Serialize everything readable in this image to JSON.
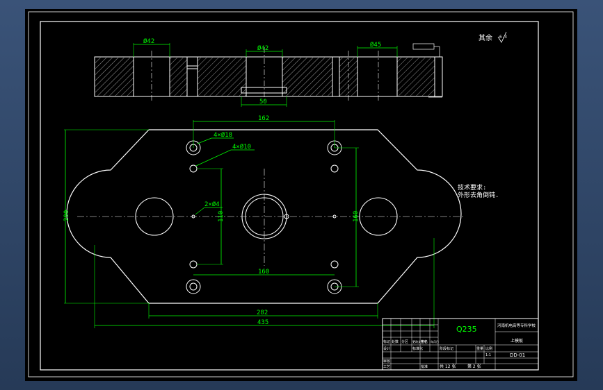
{
  "drawing": {
    "roughness_label": "其余",
    "roughness_value": "6.3",
    "tech_title": "技术要求:",
    "tech_note": "外形去角倒钝.",
    "material": "Q235",
    "school": "河南机电高等专科学校",
    "part_name": "上模板",
    "drawing_no": "DD-01",
    "scale": "1:1",
    "sheet_total": "共 12 张",
    "sheet_no": "第 2 张"
  },
  "dimensions": {
    "side_left_dia": "Ø42",
    "side_mid_dia": "Ø42",
    "side_right_dia": "Ø45",
    "side_bottom": "50",
    "top_dist": "162",
    "holes_18": "4×Ø18",
    "holes_10": "4×Ø10",
    "holes_4": "2×Ø4",
    "height_200": "200",
    "height_110": "110",
    "height_160": "160",
    "width_160": "160",
    "width_282": "282",
    "width_435": "435"
  },
  "title_block": {
    "rows": [
      "标记",
      "处数",
      "分区",
      "更改文件号",
      "签名",
      "年月日"
    ],
    "design": "设计",
    "std": "标准化",
    "stage": "阶段标记",
    "weight": "重量",
    "ratio": "比例",
    "review": "审核",
    "process": "工艺",
    "approve": "批准"
  }
}
